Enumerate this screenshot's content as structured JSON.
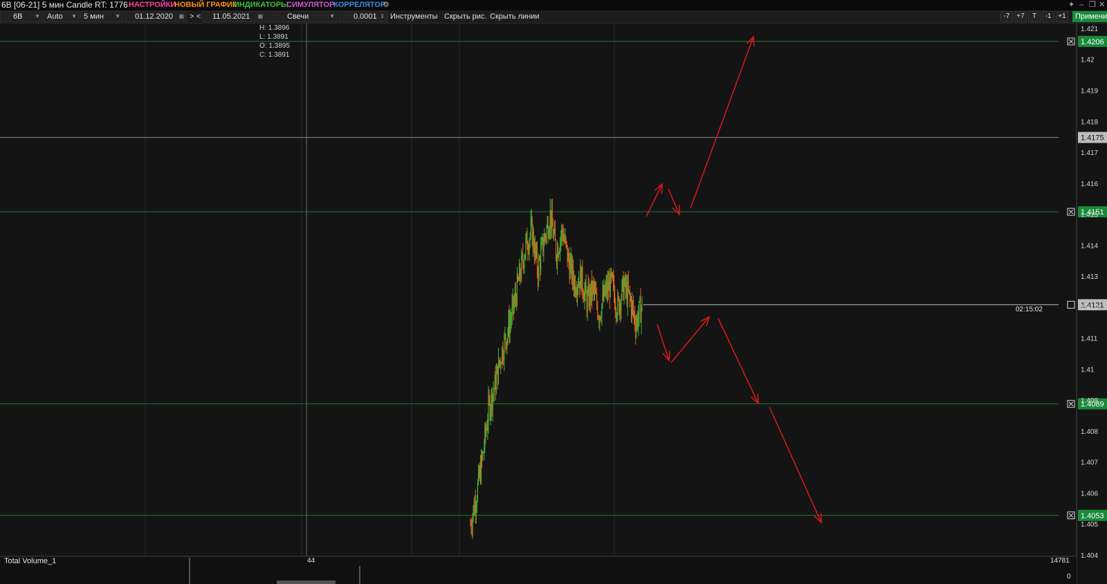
{
  "window": {
    "title": "6B [06-21] 5 мин Candle RT: 1776",
    "menu": [
      {
        "label": "НАСТРОЙКИ",
        "color": "#ff3fa0"
      },
      {
        "label": "НОВЫЙ ГРАФИК",
        "color": "#ff8c1a"
      },
      {
        "label": "ИНДИКАТОРЫ",
        "color": "#39c43a"
      },
      {
        "label": "СИМУЛЯТОР",
        "color": "#d05ad6"
      },
      {
        "label": "КОРРЕЛЯТОР",
        "color": "#3a8fe8"
      }
    ],
    "controls": [
      "pin-icon",
      "minimize-icon",
      "restore-icon",
      "close-icon"
    ]
  },
  "toolbar": {
    "symbol": "6B",
    "scale": "Auto",
    "timeframe": "5 мин",
    "date_from": "01.12.2020",
    "nav_next": ">",
    "nav_prev": "<",
    "date_to": "11.05.2021",
    "chart_type": "Свечи",
    "tick_size": "0.0001",
    "tools_label": "Инструменты",
    "hide_drawings": "Скрыть рис.",
    "hide_lines": "Скрыть линии",
    "right_buttons": [
      "-7",
      "+7",
      "T",
      "-1",
      "+1"
    ],
    "apply_label": "Применить"
  },
  "ohlc": {
    "h": "H: 1.3896",
    "l": "L: 1.3891",
    "o": "O: 1.3895",
    "c": "C: 1.3891"
  },
  "chart_data": {
    "type": "candlestick",
    "y_ticks": [
      "1.421",
      "1.42",
      "1.419",
      "1.418",
      "1.417",
      "1.416",
      "1.415",
      "1.414",
      "1.413",
      "1.412",
      "1.411",
      "1.41",
      "1.409",
      "1.408",
      "1.407",
      "1.406",
      "1.405",
      "1.404"
    ],
    "ylim": [
      1.404,
      1.4212
    ],
    "level_lines": [
      {
        "price": 1.4206,
        "label": "1.4206"
      },
      {
        "price": 1.4151,
        "label": "1.4151"
      },
      {
        "price": 1.4089,
        "label": "1.4089"
      },
      {
        "price": 1.4053,
        "label": "1.4053"
      }
    ],
    "cursor_line": {
      "price": 1.4175,
      "label": "1.4175"
    },
    "last_price": {
      "price": 1.4121,
      "label": "1.4121",
      "time_left": "02:15:02"
    },
    "ohlc_note": "close path approximates price swings",
    "close_path": [
      1.405,
      1.406,
      1.4072,
      1.4088,
      1.4095,
      1.4105,
      1.4112,
      1.412,
      1.413,
      1.414,
      1.4145,
      1.4132,
      1.4142,
      1.415,
      1.4138,
      1.4145,
      1.4135,
      1.4128,
      1.413,
      1.4122,
      1.4126,
      1.4118,
      1.4125,
      1.4128,
      1.412,
      1.4127,
      1.4123,
      1.4115,
      1.4121
    ],
    "volume": {
      "label": "Total Volume_1",
      "cursor_value": "44",
      "max": "14781",
      "zero": "0"
    },
    "annotations": "red arrows: scenarios up to 1.4206 and down to 1.4053"
  }
}
